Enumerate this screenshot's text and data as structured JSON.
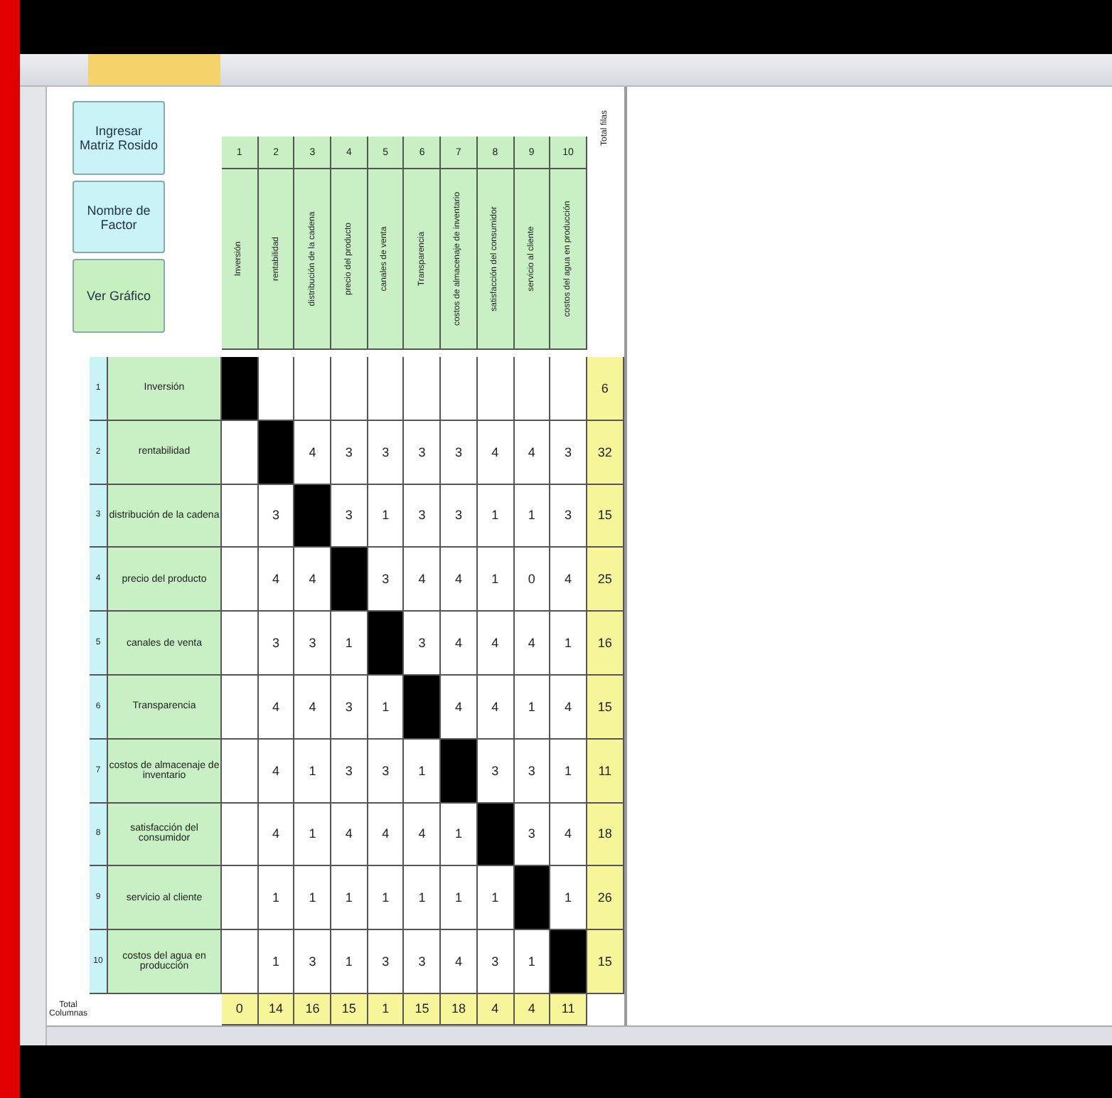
{
  "buttons": [
    {
      "label": "Ingresar Matriz Rosido",
      "kind": "cyan"
    },
    {
      "label": "Nombre de Factor",
      "kind": "cyan"
    },
    {
      "label": "Ver Gráfico",
      "kind": "green"
    }
  ],
  "total_rows_label": "Total filas",
  "column_headers": [
    {
      "index": "1",
      "label": "Inversión"
    },
    {
      "index": "2",
      "label": "rentabilidad"
    },
    {
      "index": "3",
      "label": "distribución de la cadena"
    },
    {
      "index": "4",
      "label": "precio del producto"
    },
    {
      "index": "5",
      "label": "canales de venta"
    },
    {
      "index": "6",
      "label": "Transparencia"
    },
    {
      "index": "7",
      "label": "costos de almacenaje de inventario"
    },
    {
      "index": "8",
      "label": "satisfacción del consumidor"
    },
    {
      "index": "9",
      "label": "servicio al cliente"
    },
    {
      "index": "10",
      "label": "costos del agua en producción"
    }
  ],
  "factors": [
    {
      "index": "1",
      "label": "Inversión",
      "cells": [
        {
          "kind": "diagonal"
        },
        {
          "kind": "blank"
        },
        {
          "kind": "blank"
        },
        {
          "kind": "blank"
        },
        {
          "kind": "blank"
        },
        {
          "kind": "blank"
        },
        {
          "kind": "blank"
        },
        {
          "kind": "blank"
        },
        {
          "kind": "blank"
        },
        {
          "kind": "blank"
        }
      ],
      "total": "6"
    },
    {
      "index": "2",
      "label": "rentabilidad",
      "cells": [
        {
          "kind": "blank"
        },
        {
          "kind": "diagonal"
        },
        {
          "kind": "value",
          "value": "4"
        },
        {
          "kind": "value",
          "value": "3"
        },
        {
          "kind": "value",
          "value": "3"
        },
        {
          "kind": "value",
          "value": "3"
        },
        {
          "kind": "value",
          "value": "3"
        },
        {
          "kind": "value",
          "value": "4"
        },
        {
          "kind": "value",
          "value": "4"
        },
        {
          "kind": "value",
          "value": "3"
        }
      ],
      "total": "32"
    },
    {
      "index": "3",
      "label": "distribución de la cadena",
      "cells": [
        {
          "kind": "blank"
        },
        {
          "kind": "value",
          "value": "3"
        },
        {
          "kind": "diagonal"
        },
        {
          "kind": "value",
          "value": "3"
        },
        {
          "kind": "value",
          "value": "1"
        },
        {
          "kind": "value",
          "value": "3"
        },
        {
          "kind": "value",
          "value": "3"
        },
        {
          "kind": "value",
          "value": "1"
        },
        {
          "kind": "value",
          "value": "1"
        },
        {
          "kind": "value",
          "value": "3"
        }
      ],
      "total": "15"
    },
    {
      "index": "4",
      "label": "precio del producto",
      "cells": [
        {
          "kind": "blank"
        },
        {
          "kind": "value",
          "value": "4"
        },
        {
          "kind": "value",
          "value": "4"
        },
        {
          "kind": "diagonal"
        },
        {
          "kind": "value",
          "value": "3"
        },
        {
          "kind": "value",
          "value": "4"
        },
        {
          "kind": "value",
          "value": "4"
        },
        {
          "kind": "value",
          "value": "1"
        },
        {
          "kind": "value",
          "value": "0"
        },
        {
          "kind": "value",
          "value": "4"
        }
      ],
      "total": "25"
    },
    {
      "index": "5",
      "label": "canales de venta",
      "cells": [
        {
          "kind": "blank"
        },
        {
          "kind": "value",
          "value": "3"
        },
        {
          "kind": "value",
          "value": "3"
        },
        {
          "kind": "value",
          "value": "1"
        },
        {
          "kind": "diagonal"
        },
        {
          "kind": "value",
          "value": "3"
        },
        {
          "kind": "value",
          "value": "4"
        },
        {
          "kind": "value",
          "value": "4"
        },
        {
          "kind": "value",
          "value": "4"
        },
        {
          "kind": "value",
          "value": "1"
        }
      ],
      "total": "16"
    },
    {
      "index": "6",
      "label": "Transparencia",
      "cells": [
        {
          "kind": "blank"
        },
        {
          "kind": "value",
          "value": "4"
        },
        {
          "kind": "value",
          "value": "4"
        },
        {
          "kind": "value",
          "value": "3"
        },
        {
          "kind": "value",
          "value": "1"
        },
        {
          "kind": "diagonal"
        },
        {
          "kind": "value",
          "value": "4"
        },
        {
          "kind": "value",
          "value": "4"
        },
        {
          "kind": "value",
          "value": "1"
        },
        {
          "kind": "value",
          "value": "4"
        }
      ],
      "total": "15"
    },
    {
      "index": "7",
      "label": "costos de almacenaje de inventario",
      "cells": [
        {
          "kind": "blank"
        },
        {
          "kind": "value",
          "value": "4"
        },
        {
          "kind": "value",
          "value": "1"
        },
        {
          "kind": "value",
          "value": "3"
        },
        {
          "kind": "value",
          "value": "3"
        },
        {
          "kind": "value",
          "value": "1"
        },
        {
          "kind": "diagonal"
        },
        {
          "kind": "value",
          "value": "3"
        },
        {
          "kind": "value",
          "value": "3"
        },
        {
          "kind": "value",
          "value": "1"
        }
      ],
      "total": "11"
    },
    {
      "index": "8",
      "label": "satisfacción del consumidor",
      "cells": [
        {
          "kind": "blank"
        },
        {
          "kind": "value",
          "value": "4"
        },
        {
          "kind": "value",
          "value": "1"
        },
        {
          "kind": "value",
          "value": "4"
        },
        {
          "kind": "value",
          "value": "4"
        },
        {
          "kind": "value",
          "value": "4"
        },
        {
          "kind": "value",
          "value": "1"
        },
        {
          "kind": "diagonal"
        },
        {
          "kind": "value",
          "value": "3"
        },
        {
          "kind": "value",
          "value": "4"
        }
      ],
      "total": "18"
    },
    {
      "index": "9",
      "label": "servicio al cliente",
      "cells": [
        {
          "kind": "blank"
        },
        {
          "kind": "value",
          "value": "1"
        },
        {
          "kind": "value",
          "value": "1"
        },
        {
          "kind": "value",
          "value": "1"
        },
        {
          "kind": "value",
          "value": "1"
        },
        {
          "kind": "value",
          "value": "1"
        },
        {
          "kind": "value",
          "value": "1"
        },
        {
          "kind": "value",
          "value": "1"
        },
        {
          "kind": "diagonal"
        },
        {
          "kind": "value",
          "value": "1"
        }
      ],
      "total": "26"
    },
    {
      "index": "10",
      "label": "costos del agua en producción",
      "cells": [
        {
          "kind": "blank"
        },
        {
          "kind": "value",
          "value": "1"
        },
        {
          "kind": "value",
          "value": "3"
        },
        {
          "kind": "value",
          "value": "1"
        },
        {
          "kind": "value",
          "value": "3"
        },
        {
          "kind": "value",
          "value": "3"
        },
        {
          "kind": "value",
          "value": "4"
        },
        {
          "kind": "value",
          "value": "3"
        },
        {
          "kind": "value",
          "value": "1"
        },
        {
          "kind": "diagonal"
        }
      ],
      "total": "15"
    }
  ],
  "column_totals_label": "Total Columnas",
  "column_totals": [
    "0",
    "14",
    "16",
    "15",
    "1",
    "15",
    "18",
    "4",
    "4",
    "11"
  ]
}
